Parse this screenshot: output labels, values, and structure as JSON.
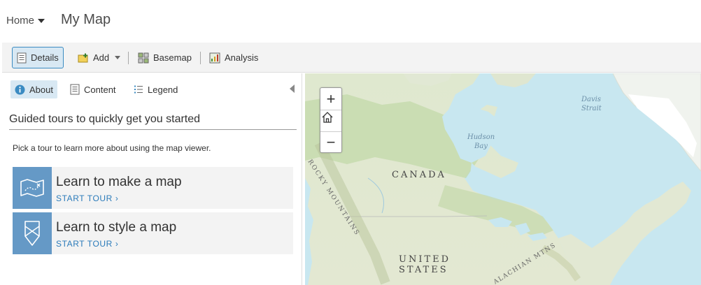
{
  "header": {
    "home_label": "Home",
    "map_title": "My Map"
  },
  "toolbar": {
    "details": "Details",
    "add": "Add",
    "basemap": "Basemap",
    "analysis": "Analysis"
  },
  "panel": {
    "tabs": {
      "about": "About",
      "content": "Content",
      "legend": "Legend"
    },
    "section_title": "Guided tours to quickly get you started",
    "intro": "Pick a tour to learn more about using the map viewer.",
    "tours": [
      {
        "title": "Learn to make a map",
        "link": "START TOUR ›",
        "icon": "map-tour-icon"
      },
      {
        "title": "Learn to style a map",
        "link": "START TOUR ›",
        "icon": "style-tour-icon"
      }
    ]
  },
  "map": {
    "zoom_in": "+",
    "zoom_out": "−",
    "labels": {
      "davis_1": "Davis",
      "davis_2": "Strait",
      "hudson_1": "Hudson",
      "hudson_2": "Bay",
      "canada": "CANADA",
      "rocky": "ROCKY MOUNTAINS",
      "united": "UNITED",
      "states": "STATES",
      "appalachian": "ALACHIAN MTNS"
    }
  },
  "colors": {
    "accent": "#3b8bc2",
    "tour_icon_bg": "#6599c6",
    "link": "#2b7bba",
    "water": "#c8e7f0",
    "land": "#dde8c8",
    "forest": "#b9d3a0"
  }
}
